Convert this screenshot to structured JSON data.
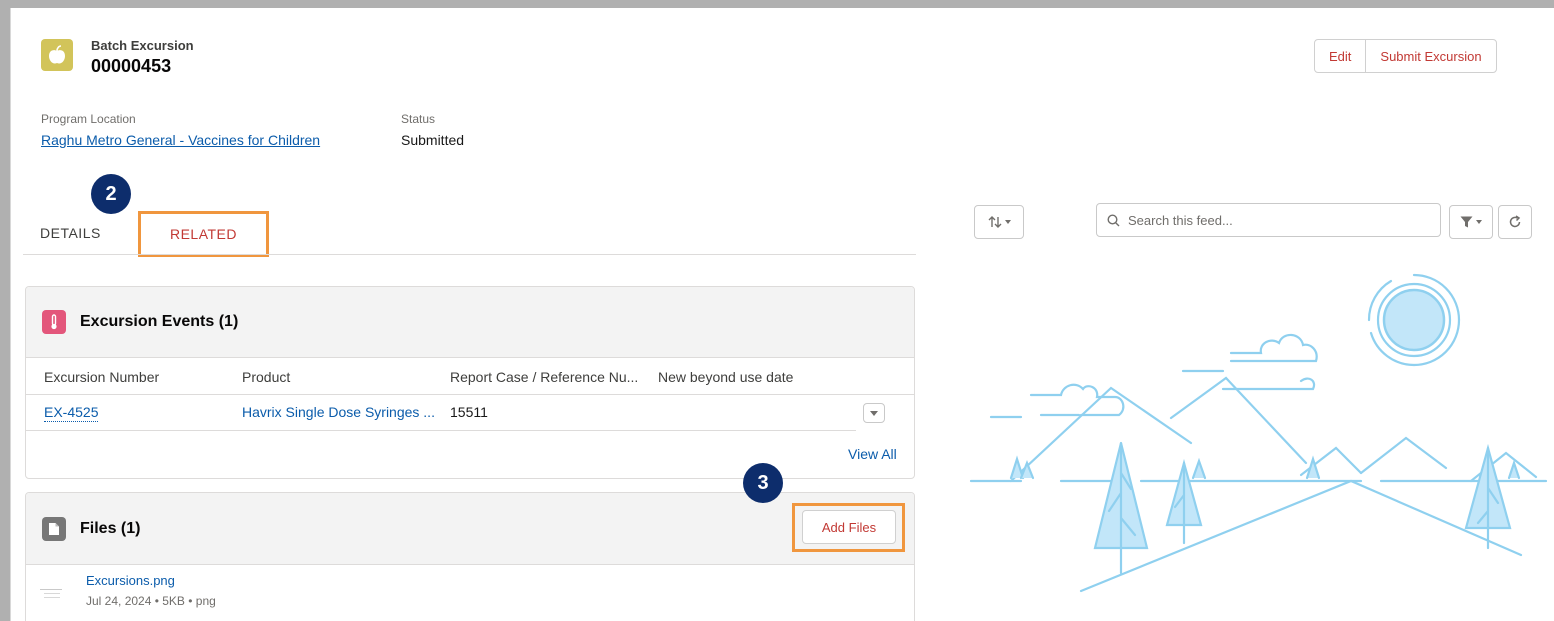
{
  "header": {
    "object_label": "Batch Excursion",
    "record_number": "00000453",
    "icon": "apple-icon",
    "actions": {
      "edit": "Edit",
      "submit": "Submit Excursion"
    }
  },
  "fields": {
    "program_location_label": "Program Location",
    "program_location_value": "Raghu Metro General - Vaccines for Children",
    "status_label": "Status",
    "status_value": "Submitted"
  },
  "steps": {
    "tabs_step": "2",
    "add_files_step": "3"
  },
  "tabs": {
    "details": "DETAILS",
    "related": "RELATED"
  },
  "excursion_events": {
    "title": "Excursion Events (1)",
    "icon": "thermometer-icon",
    "columns": [
      "Excursion Number",
      "Product",
      "Report Case / Reference Nu...",
      "New beyond use date"
    ],
    "rows": [
      {
        "number": "EX-4525",
        "product": "Havrix Single Dose Syringes ...",
        "reference": "15511",
        "bud": ""
      }
    ],
    "view_all": "View All"
  },
  "files": {
    "title": "Files (1)",
    "icon": "file-icon",
    "add_button": "Add Files",
    "items": [
      {
        "name": "Excursions.png",
        "meta": "Jul 24, 2024 • 5KB • png"
      }
    ]
  },
  "feed": {
    "search_placeholder": "Search this feed...",
    "sort_icon": "sort-arrows-icon",
    "filter_icon": "filter-icon",
    "refresh_icon": "refresh-icon"
  },
  "colors": {
    "accent_red": "#c23934",
    "link_blue": "#0b5cab",
    "highlight_orange": "#f0963e",
    "step_badge": "#0d2d6c",
    "record_icon_bg": "#d2c45a",
    "events_icon_bg": "#e3567b",
    "files_icon_bg": "#777777",
    "illustration_blue": "#8fd0ef"
  }
}
